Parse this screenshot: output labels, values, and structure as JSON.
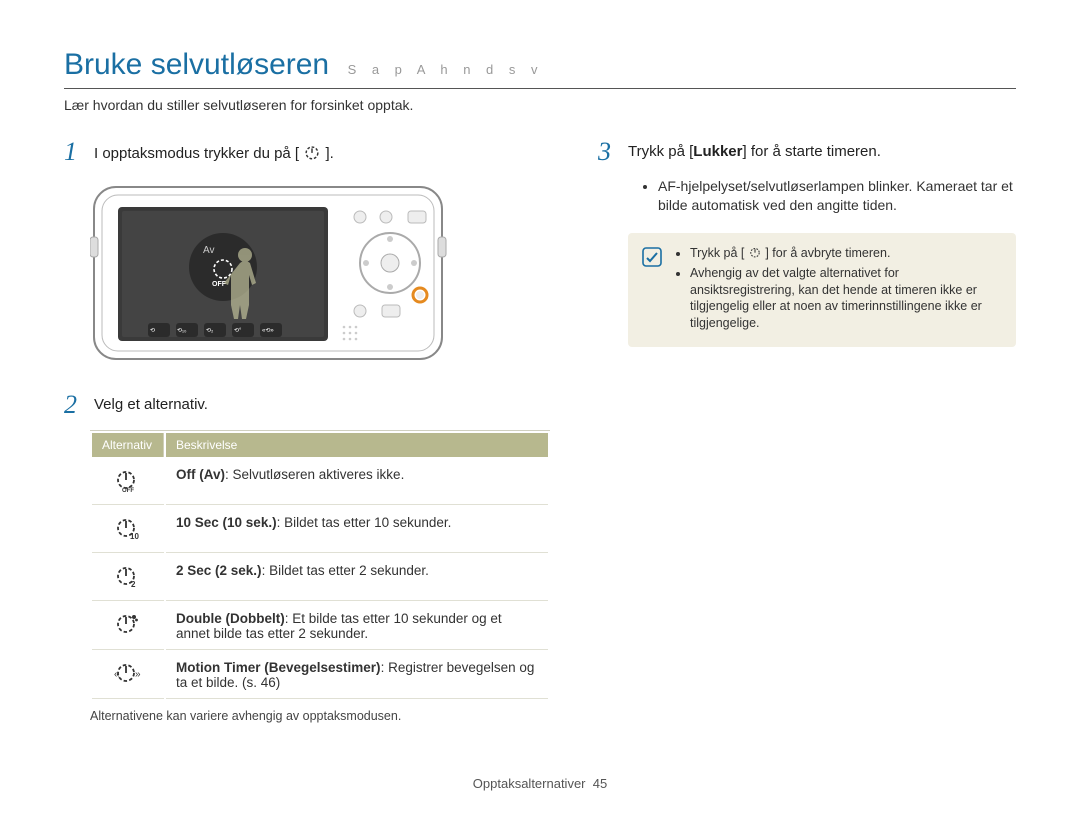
{
  "header": {
    "title": "Bruke selvutløseren",
    "subtitle": "S a   p A h n d   s v"
  },
  "intro": "Lær hvordan du stiller selvutløseren for forsinket opptak.",
  "steps": {
    "s1": {
      "num": "1",
      "text_before": "I opptaksmodus trykker du på [",
      "text_after": "]."
    },
    "s2": {
      "num": "2",
      "text": "Velg et alternativ."
    },
    "s3": {
      "num": "3",
      "text_before": "Trykk på [",
      "bold": "Lukker",
      "text_after": "] for å starte timeren."
    }
  },
  "camera_label": "Av",
  "table": {
    "head": {
      "col1": "Alternativ",
      "col2": "Beskrivelse"
    },
    "rows": [
      {
        "icon": "off",
        "bold": "Off (Av)",
        "rest": ": Selvutløseren aktiveres ikke."
      },
      {
        "icon": "10",
        "bold": "10 Sec (10 sek.)",
        "rest": ": Bildet tas etter 10 sekunder."
      },
      {
        "icon": "2",
        "bold": "2 Sec (2 sek.)",
        "rest": ": Bildet tas etter 2 sekunder."
      },
      {
        "icon": "double",
        "bold": "Double (Dobbelt)",
        "rest": ": Et bilde tas etter 10 sekunder og et annet bilde tas etter 2 sekunder."
      },
      {
        "icon": "motion",
        "bold": "Motion Timer (Bevegelsestimer)",
        "rest": ": Registrer bevegelsen og ta et bilde. (s. 46)"
      }
    ],
    "note": "Alternativene kan variere avhengig av opptaksmodusen."
  },
  "step3_bullet": "AF-hjelpelyset/selvutløserlampen blinker. Kameraet tar et bilde automatisk ved den angitte tiden.",
  "notebox": {
    "items": [
      "Trykk på [ t ] for å avbryte timeren.",
      "Avhengig av det valgte alternativet for ansiktsregistrering, kan det hende at timeren ikke er tilgjengelig eller at noen av timerinnstillingene ikke er tilgjengelige."
    ]
  },
  "footer": {
    "section": "Opptaksalternativer",
    "page": "45"
  }
}
